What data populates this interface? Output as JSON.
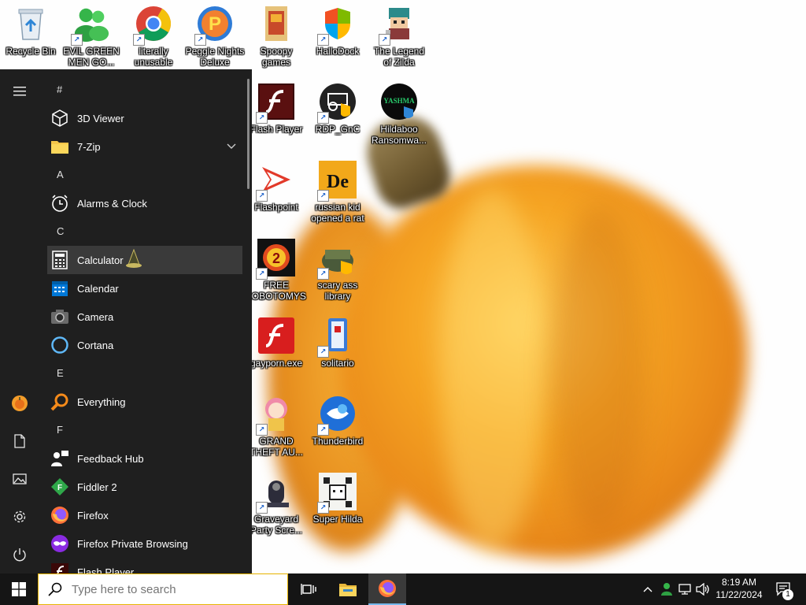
{
  "desktop": {
    "icons": [
      {
        "label": "Recycle Bin"
      },
      {
        "label": "EVIL GREEN MEN GO..."
      },
      {
        "label": "literally unusable"
      },
      {
        "label": "Peggle Nights Deluxe"
      },
      {
        "label": "Spoopy games"
      },
      {
        "label": "HalloDock"
      },
      {
        "label": "The Legend of Zilda"
      },
      {
        "label": "Flash Player"
      },
      {
        "label": "RDP_GnC"
      },
      {
        "label": "Hildaboo Ransomwa..."
      },
      {
        "label": "Flashpoint"
      },
      {
        "label": "russian kid opened a rat"
      },
      {
        "label": "FREE LOBOTOMYS"
      },
      {
        "label": "scary ass library"
      },
      {
        "label": "gayporn.exe"
      },
      {
        "label": "solitario"
      },
      {
        "label": "GRAND THEFT AU..."
      },
      {
        "label": "Thunderbird"
      },
      {
        "label": "Graveyard Party Scre..."
      },
      {
        "label": "Super Hilda"
      }
    ],
    "yashma_text": "YASHMA",
    "lobotomy_digit": "2",
    "de_text": "De"
  },
  "start_menu": {
    "headers": {
      "hash": "#",
      "a": "A",
      "c": "C",
      "e": "E",
      "f": "F"
    },
    "apps": {
      "viewer3d": "3D Viewer",
      "zip": "7-Zip",
      "alarms": "Alarms & Clock",
      "calculator": "Calculator",
      "calendar": "Calendar",
      "camera": "Camera",
      "cortana": "Cortana",
      "everything": "Everything",
      "feedback": "Feedback Hub",
      "fiddler": "Fiddler 2",
      "firefox": "Firefox",
      "firefox_private": "Firefox Private Browsing",
      "flash": "Flash Player"
    },
    "selected_app": "Calculator"
  },
  "taskbar": {
    "search_placeholder": "Type here to search",
    "time": "8:19 AM",
    "date": "11/22/2024",
    "notification_count": "1"
  },
  "colors": {
    "start_bg": "#1f1f1f",
    "taskbar_bg": "#151515",
    "accent_blue": "#0078d7",
    "pumpkin_orange": "#f6a523"
  }
}
